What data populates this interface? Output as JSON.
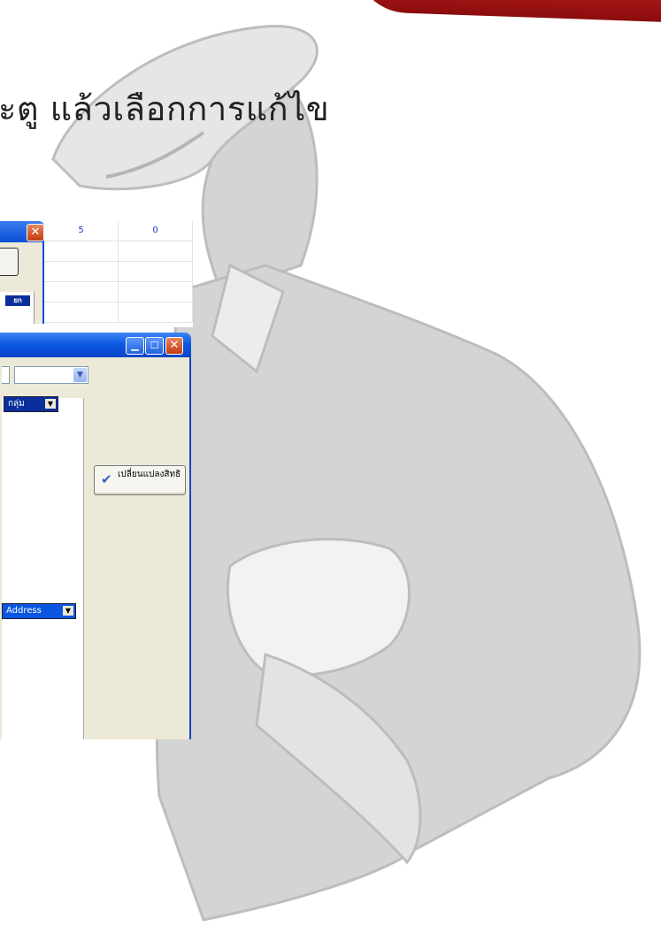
{
  "slide": {
    "title": "ะตู แล้วเลือกการแก้ไข"
  },
  "top_window": {
    "close_icon": "close-icon",
    "label_fragment": "ยก"
  },
  "grid_values": {
    "header": [
      "5",
      "0"
    ]
  },
  "main_window": {
    "minimize_icon": "minimize-icon",
    "maximize_icon": "maximize-icon",
    "close_icon": "close-icon",
    "combo_value": "",
    "column_group": "กลุ่ม",
    "column_address": "Address",
    "change_permission_button": "เปลี่ยนแปลงสิทธิ"
  },
  "colors": {
    "xp_blue": "#0a56e0",
    "panel_bg": "#ece9d8",
    "header_blue": "#0a2f9c",
    "accent_red": "#b01515"
  }
}
